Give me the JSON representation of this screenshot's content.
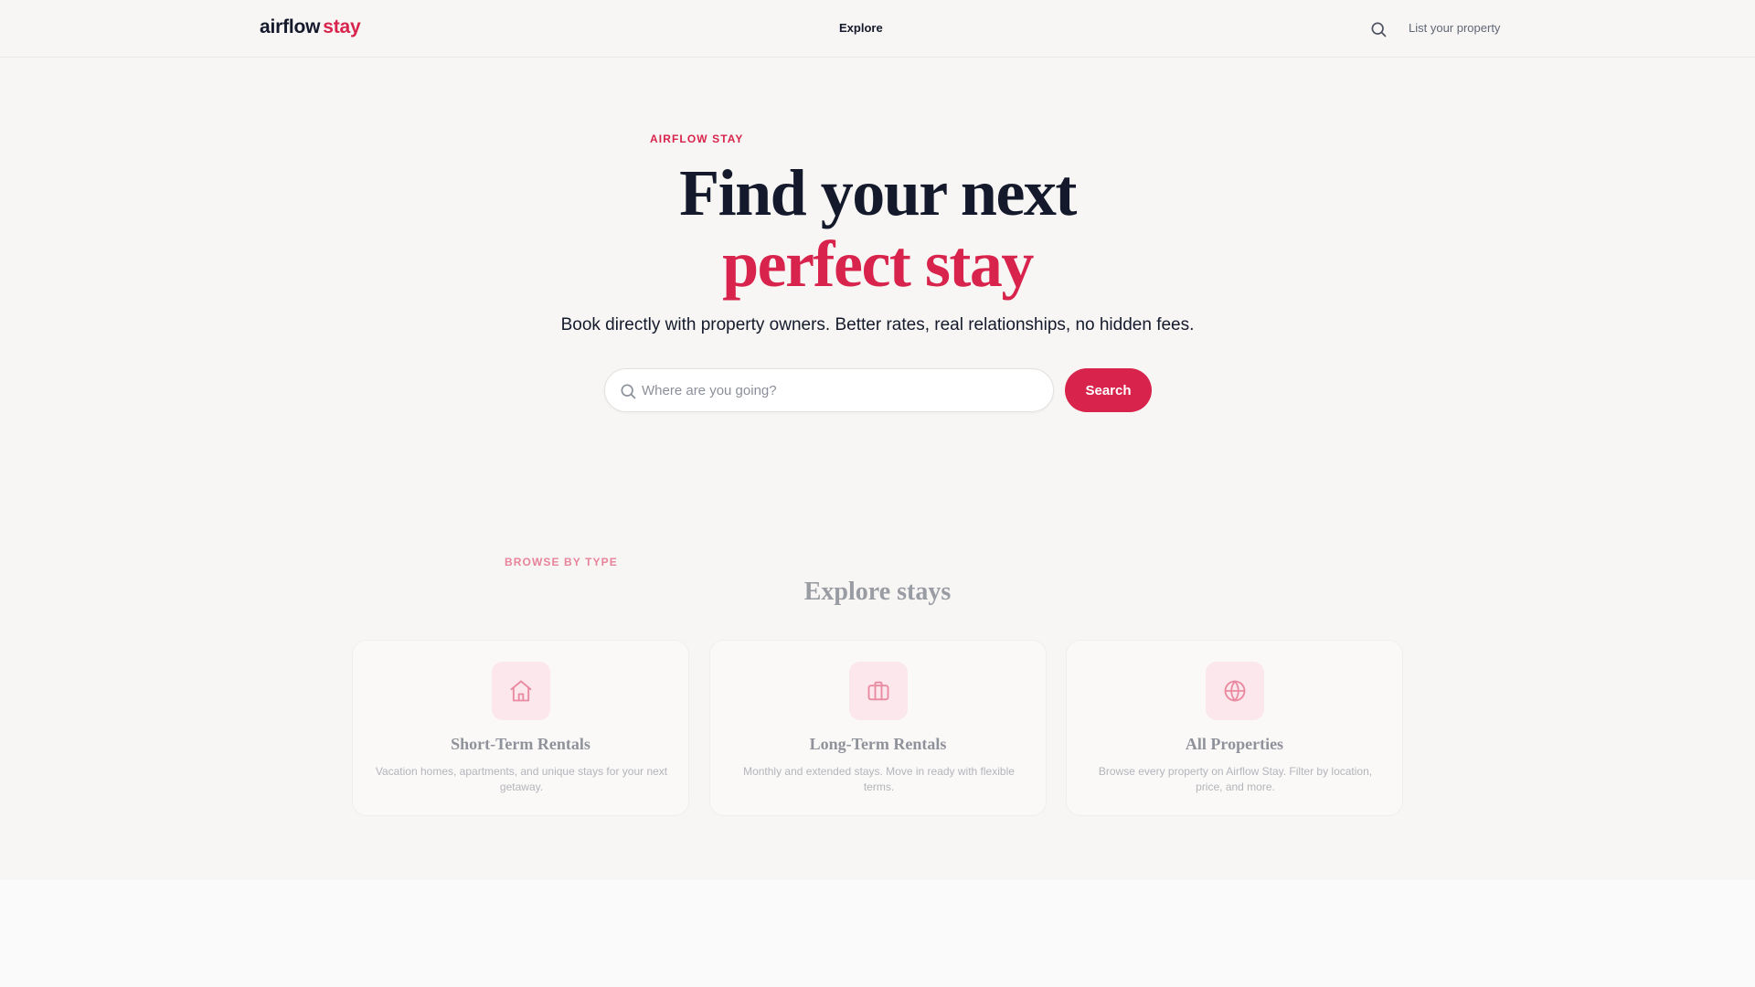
{
  "header": {
    "logo_main": "airflow",
    "logo_accent": "stay",
    "nav_explore": "Explore",
    "list_property": "List your property",
    "search_icon": "search-icon"
  },
  "hero": {
    "eyebrow": "AIRFLOW STAY",
    "title_line1": "Find your next",
    "title_line2": "perfect stay",
    "subtitle": "Book directly with property owners. Better rates, real relationships, no hidden fees.",
    "search_placeholder": "Where are you going?",
    "search_value": "",
    "search_button": "Search"
  },
  "browse": {
    "eyebrow": "BROWSE BY TYPE",
    "title": "Explore stays",
    "cards": [
      {
        "icon": "home-icon",
        "title": "Short-Term Rentals",
        "description": "Vacation homes, apartments, and unique stays for your next getaway."
      },
      {
        "icon": "briefcase-icon",
        "title": "Long-Term Rentals",
        "description": "Monthly and extended stays. Move in ready with flexible terms."
      },
      {
        "icon": "globe-icon",
        "title": "All Properties",
        "description": "Browse every property on Airflow Stay. Filter by location, price, and more."
      }
    ]
  },
  "colors": {
    "accent": "#d8244c",
    "text_dark": "#141a2b",
    "background": "#f7f6f4"
  }
}
